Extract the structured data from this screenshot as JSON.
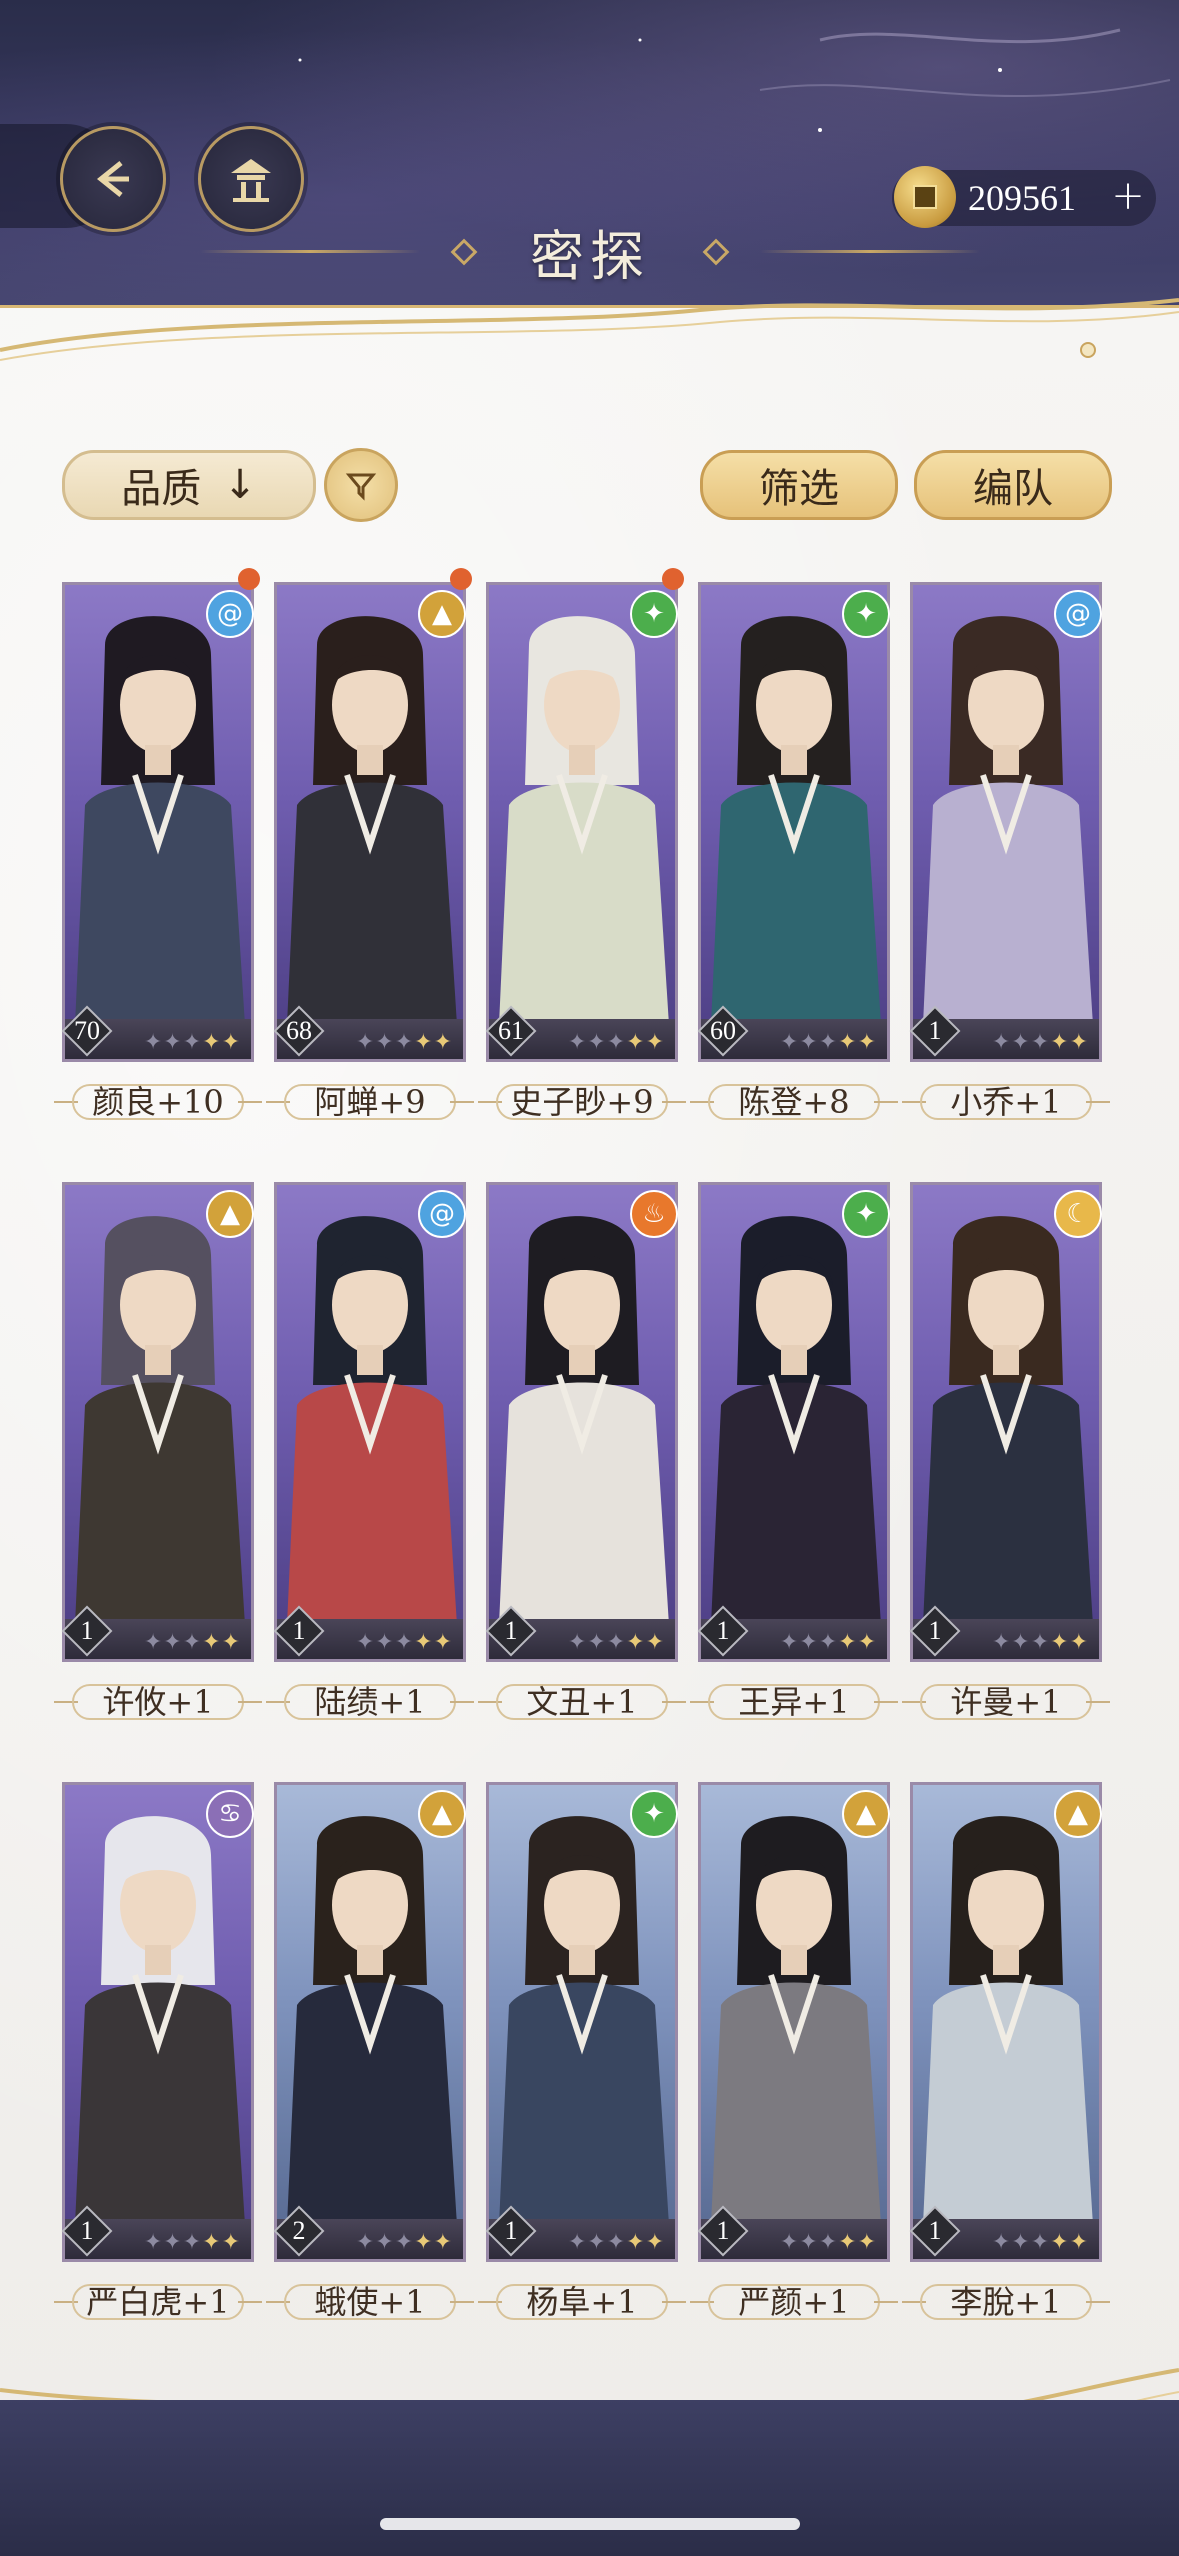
{
  "header": {
    "title": "密探",
    "currency_value": "209561",
    "currency_plus": "+"
  },
  "toolbar": {
    "quality_label": "品质",
    "quality_sort_arrow": "↓",
    "filter_label": "筛选",
    "team_label": "编队"
  },
  "colors": {
    "accent_gold": "#e6c27a",
    "element_blue": "#4fa3e0",
    "element_gold": "#d2a23a",
    "element_green": "#4cae4c",
    "element_fire": "#e8782c",
    "element_moon": "#e8b84a",
    "element_purple": "#8b6fb6",
    "notification_dot": "#e0622f"
  },
  "cards": [
    {
      "name": "颜良+10",
      "level": "70",
      "element": "water-swirl-icon",
      "stars": 5,
      "bg": "purple",
      "notify": true
    },
    {
      "name": "阿蝉+9",
      "level": "68",
      "element": "mountain-icon",
      "stars": 5,
      "bg": "purple",
      "notify": true
    },
    {
      "name": "史子眇+9",
      "level": "61",
      "element": "wind-leaf-icon",
      "stars": 5,
      "bg": "purple",
      "notify": true
    },
    {
      "name": "陈登+8",
      "level": "60",
      "element": "wind-leaf-icon",
      "stars": 5,
      "bg": "purple",
      "notify": false
    },
    {
      "name": "小乔+1",
      "level": "1",
      "element": "water-swirl-icon",
      "stars": 5,
      "bg": "purple",
      "notify": false
    },
    {
      "name": "许攸+1",
      "level": "1",
      "element": "mountain-icon",
      "stars": 5,
      "bg": "purple",
      "notify": false
    },
    {
      "name": "陆绩+1",
      "level": "1",
      "element": "water-swirl-icon",
      "stars": 5,
      "bg": "purple",
      "notify": false
    },
    {
      "name": "文丑+1",
      "level": "1",
      "element": "fire-icon",
      "stars": 5,
      "bg": "purple",
      "notify": false
    },
    {
      "name": "王异+1",
      "level": "1",
      "element": "wind-leaf-icon",
      "stars": 5,
      "bg": "purple",
      "notify": false
    },
    {
      "name": "许曼+1",
      "level": "1",
      "element": "moon-icon",
      "stars": 5,
      "bg": "purple",
      "notify": false
    },
    {
      "name": "严白虎+1",
      "level": "1",
      "element": "dark-swirl-icon",
      "stars": 5,
      "bg": "purple",
      "notify": false
    },
    {
      "name": "蛾使+1",
      "level": "2",
      "element": "mountain-icon",
      "stars": 5,
      "bg": "blue",
      "notify": false
    },
    {
      "name": "杨阜+1",
      "level": "1",
      "element": "wind-leaf-icon",
      "stars": 5,
      "bg": "blue",
      "notify": false
    },
    {
      "name": "严颜+1",
      "level": "1",
      "element": "mountain-icon",
      "stars": 5,
      "bg": "blue",
      "notify": false
    },
    {
      "name": "李脫+1",
      "level": "1",
      "element": "mountain-icon",
      "stars": 5,
      "bg": "blue",
      "notify": false
    }
  ]
}
